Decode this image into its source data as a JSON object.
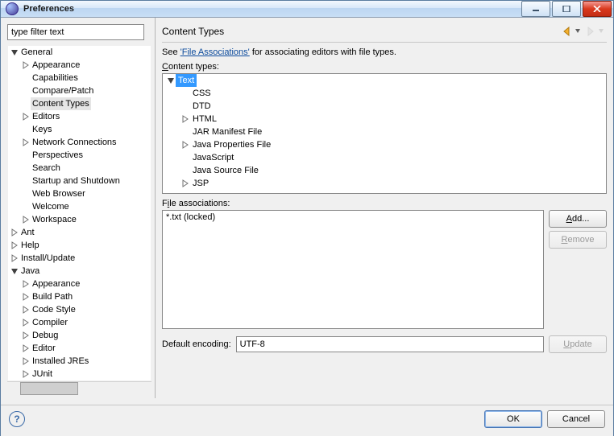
{
  "window": {
    "title": "Preferences"
  },
  "filter": {
    "placeholder": "type filter text"
  },
  "nav": {
    "items": [
      {
        "label": "General",
        "expanded": true,
        "children": [
          {
            "label": "Appearance",
            "hasChildren": true
          },
          {
            "label": "Capabilities"
          },
          {
            "label": "Compare/Patch"
          },
          {
            "label": "Content Types",
            "selected": true
          },
          {
            "label": "Editors",
            "hasChildren": true
          },
          {
            "label": "Keys"
          },
          {
            "label": "Network Connections",
            "hasChildren": true
          },
          {
            "label": "Perspectives"
          },
          {
            "label": "Search"
          },
          {
            "label": "Startup and Shutdown"
          },
          {
            "label": "Web Browser"
          },
          {
            "label": "Welcome"
          },
          {
            "label": "Workspace",
            "hasChildren": true
          }
        ]
      },
      {
        "label": "Ant",
        "hasChildren": true
      },
      {
        "label": "Help",
        "hasChildren": true
      },
      {
        "label": "Install/Update",
        "hasChildren": true
      },
      {
        "label": "Java",
        "expanded": true,
        "children": [
          {
            "label": "Appearance",
            "hasChildren": true
          },
          {
            "label": "Build Path",
            "hasChildren": true
          },
          {
            "label": "Code Style",
            "hasChildren": true
          },
          {
            "label": "Compiler",
            "hasChildren": true
          },
          {
            "label": "Debug",
            "hasChildren": true
          },
          {
            "label": "Editor",
            "hasChildren": true
          },
          {
            "label": "Installed JREs",
            "hasChildren": true
          },
          {
            "label": "JUnit",
            "hasChildren": true
          }
        ]
      }
    ]
  },
  "page": {
    "title": "Content Types",
    "info_pre": "See ",
    "info_link": "'File Associations'",
    "info_post": " for associating editors with file types.",
    "content_types_label": "Content types:",
    "file_assoc_label_pre": "F",
    "file_assoc_label_ul": "i",
    "file_assoc_label_post": "le associations:",
    "encoding_label_pre": "Default ",
    "encoding_label_ul": "e",
    "encoding_label_post": "ncoding:",
    "encoding_value": "UTF-8",
    "add_label": "Add...",
    "remove_label": "Remove",
    "update_label": "Update"
  },
  "content_types": {
    "root": {
      "label": "Text",
      "expanded": true,
      "selected": true,
      "children": [
        {
          "label": "CSS"
        },
        {
          "label": "DTD"
        },
        {
          "label": "HTML",
          "hasChildren": true
        },
        {
          "label": "JAR Manifest File"
        },
        {
          "label": "Java Properties File",
          "hasChildren": true
        },
        {
          "label": "JavaScript"
        },
        {
          "label": "Java Source File"
        },
        {
          "label": "JSP",
          "hasChildren": true
        }
      ]
    }
  },
  "file_associations": {
    "items": [
      "*.txt (locked)"
    ]
  },
  "buttons": {
    "ok": "OK",
    "cancel": "Cancel"
  }
}
